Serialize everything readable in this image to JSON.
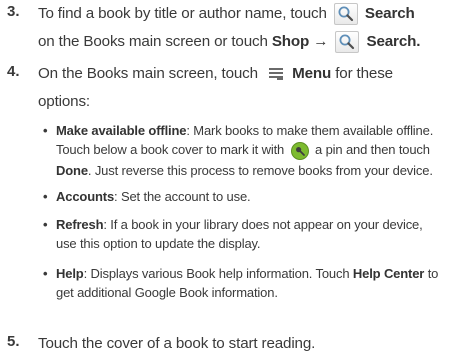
{
  "steps": [
    {
      "number": "3.",
      "line1_before": "To find a book by title or author name, touch",
      "line1_bold": "Search",
      "line2_before": "on the Books main screen or touch",
      "line2_bold": "Shop",
      "arrow": "→",
      "line2_bold2": "Search."
    },
    {
      "number": "4.",
      "line1_before": "On the Books main screen, touch",
      "line1_bold": "Menu",
      "line1_after": "for these",
      "line2": "options:"
    },
    {
      "number": "5.",
      "text": "Touch the cover of a book to start reading."
    }
  ],
  "bullets": [
    {
      "dot": "•",
      "bold": "Make available offline",
      "text1": ": Mark books to make them available offline.",
      "text2_before": "Touch below a book cover to mark it with",
      "text2_after": "a pin and then touch",
      "done": "Done",
      "text3": ". Just reverse this process to remove books from your device."
    },
    {
      "dot": "•",
      "bold": "Accounts",
      "text1": ": Set the account to use."
    },
    {
      "dot": "•",
      "bold": "Refresh",
      "text1": ": If a book in your library does not appear on your device,",
      "text2": "use this option to update the display."
    },
    {
      "dot": "•",
      "bold": "Help",
      "text1": ": Displays various Book help information. Touch",
      "bold2": "Help Center",
      "text1_after": "to",
      "text2": "get additional Google Book information."
    }
  ],
  "icons": {
    "search": "search-icon",
    "menu": "menu-icon",
    "pin": "pin-icon"
  },
  "colors": {
    "text": "#3a3a3a",
    "pin_green": "#7dbb2f"
  }
}
